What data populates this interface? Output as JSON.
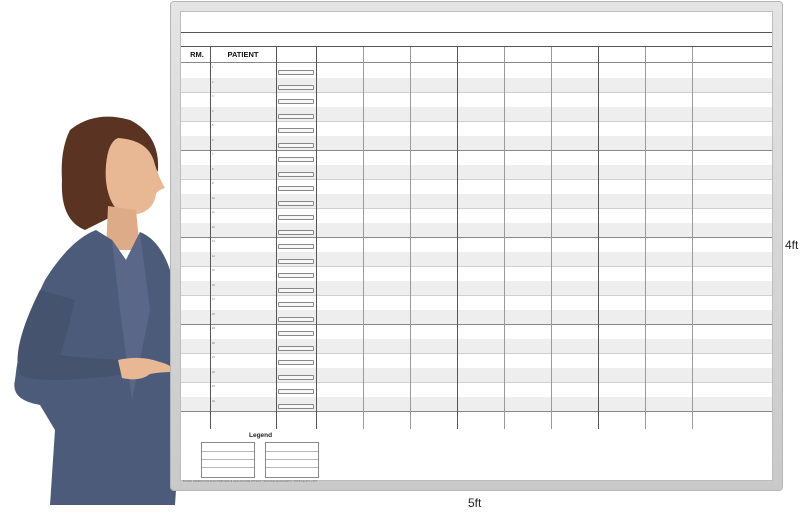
{
  "board": {
    "header_rm": "RM.",
    "header_patient": "PATIENT",
    "row_numbers": [
      "1",
      "2",
      "3",
      "4",
      "5",
      "6",
      "7",
      "8",
      "9",
      "10",
      "11",
      "12",
      "13",
      "14",
      "15",
      "16",
      "17",
      "18",
      "19",
      "20",
      "21",
      "22",
      "23",
      "24"
    ],
    "legend_title": "Legend",
    "fine_print": "BOARD DIMENSIONS ■ WHITEBOARD ■ HEALTHCARE PATIENT TRACKING ■ MAGNETIC STRIPS ■ 4FT x 5FT"
  },
  "dimensions": {
    "height_label": "4ft",
    "width_label": "5ft"
  },
  "colors": {
    "jacket": "#4d5b7a",
    "hair": "#5a3322",
    "skin": "#e8b895",
    "frame": "#d2d2d2"
  }
}
